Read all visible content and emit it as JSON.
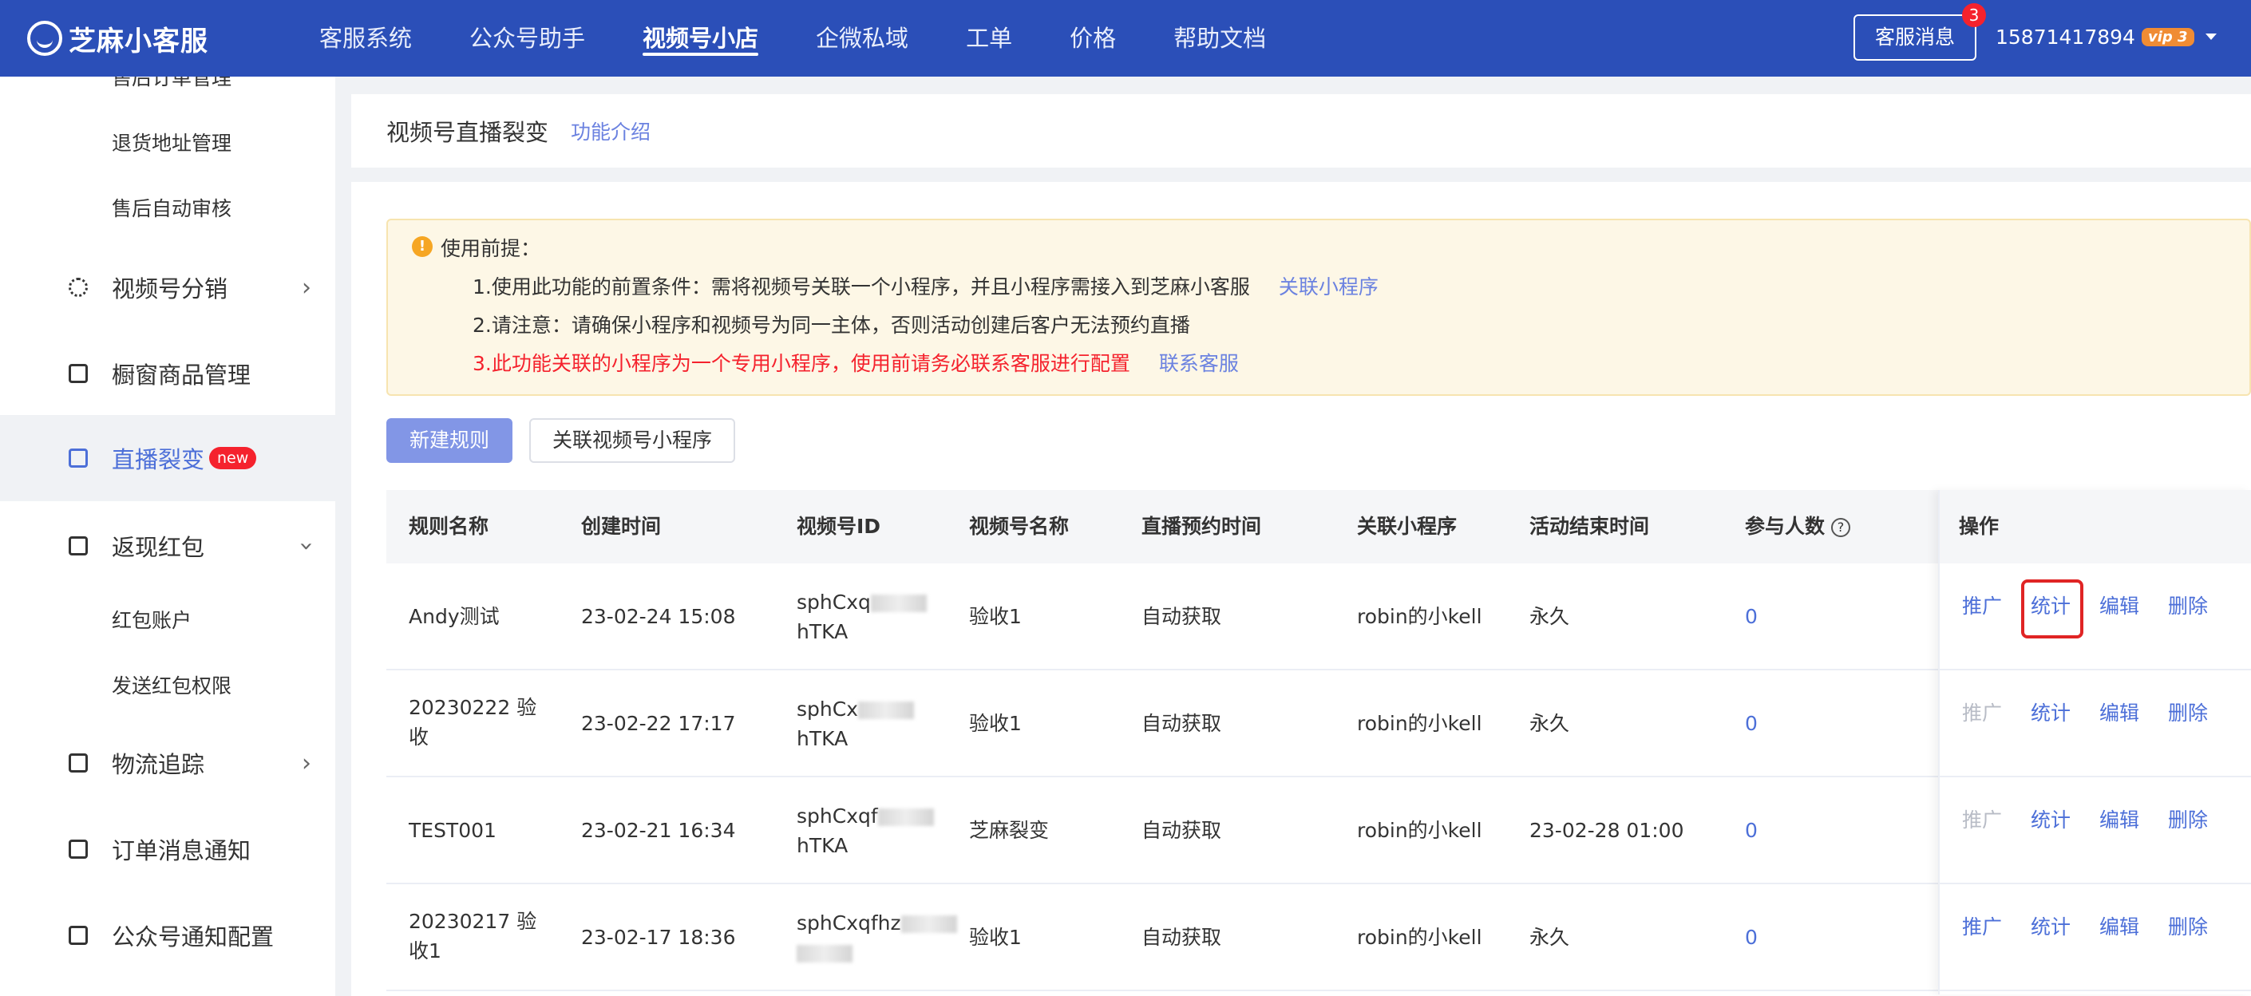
{
  "topbar": {
    "logo_text": "芝麻小客服",
    "nav": [
      "客服系统",
      "公众号助手",
      "视频号小店",
      "企微私域",
      "工单",
      "价格",
      "帮助文档"
    ],
    "active_nav": "视频号小店",
    "message_button": "客服消息",
    "message_badge": "3",
    "user_phone": "15871417894",
    "vip_label": "vip",
    "vip_level": "3"
  },
  "sidebar": {
    "cut_item": "售后订单管理",
    "items": [
      {
        "label": "退货地址管理",
        "level": "sub"
      },
      {
        "label": "售后自动审核",
        "level": "sub"
      },
      {
        "label": "视频号分销",
        "level": "main",
        "arrow": "right",
        "icon": "share-icon"
      },
      {
        "label": "橱窗商品管理",
        "level": "main",
        "icon": "shop-icon"
      },
      {
        "label": "直播裂变",
        "level": "main",
        "icon": "live-icon",
        "badge": "new",
        "active": true
      },
      {
        "label": "返现红包",
        "level": "main",
        "arrow": "down",
        "icon": "redpacket-icon"
      },
      {
        "label": "红包账户",
        "level": "sub"
      },
      {
        "label": "发送红包权限",
        "level": "sub"
      },
      {
        "label": "物流追踪",
        "level": "main",
        "arrow": "right",
        "icon": "truck-icon"
      },
      {
        "label": "订单消息通知",
        "level": "main",
        "icon": "clipboard-icon"
      },
      {
        "label": "公众号通知配置",
        "level": "main",
        "icon": "clipboard-icon"
      }
    ]
  },
  "header": {
    "title": "视频号直播裂变",
    "intro_link": "功能介绍"
  },
  "notice": {
    "title": "使用前提：",
    "line1": "1.使用此功能的前置条件：需将视频号关联一个小程序，并且小程序需接入到芝麻小客服",
    "line1_link": "关联小程序",
    "line2": "2.请注意：请确保小程序和视频号为同一主体，否则活动创建后客户无法预约直播",
    "line3": "3.此功能关联的小程序为一个专用小程序，使用前请务必联系客服进行配置",
    "line3_link": "联系客服"
  },
  "buttons": {
    "new_rule": "新建规则",
    "link_miniprogram": "关联视频号小程序"
  },
  "table": {
    "headers": [
      "规则名称",
      "创建时间",
      "视频号ID",
      "视频号名称",
      "直播预约时间",
      "关联小程序",
      "活动结束时间",
      "参与人数",
      "操作"
    ],
    "help_symbol": "?",
    "rows": [
      {
        "name": "Andy测试",
        "created": "23-02-24 15:08",
        "id_top": "sphCxq",
        "id_bottom": "hTKA",
        "channel": "验收1",
        "reserve": "自动获取",
        "mini": "robin的小kell",
        "end": "永久",
        "count": "0",
        "promote_enabled": true
      },
      {
        "name": "20230222 验收",
        "created": "23-02-22 17:17",
        "id_top": "sphCx",
        "id_bottom": "hTKA",
        "channel": "验收1",
        "reserve": "自动获取",
        "mini": "robin的小kell",
        "end": "永久",
        "count": "0",
        "promote_enabled": false
      },
      {
        "name": "TEST001",
        "created": "23-02-21 16:34",
        "id_top": "sphCxqf",
        "id_bottom": "hTKA",
        "channel": "芝麻裂变",
        "reserve": "自动获取",
        "mini": "robin的小kell",
        "end": "23-02-28 01:00",
        "count": "0",
        "promote_enabled": false
      },
      {
        "name": "20230217 验收1",
        "created": "23-02-17 18:36",
        "id_top": "sphCxqfhz",
        "id_bottom": "",
        "channel": "验收1",
        "reserve": "自动获取",
        "mini": "robin的小kell",
        "end": "永久",
        "count": "0",
        "promote_enabled": true
      }
    ],
    "ops": {
      "promote": "推广",
      "stats": "统计",
      "edit": "编辑",
      "delete": "删除"
    }
  },
  "colors": {
    "primary": "#2b4fb8",
    "link": "#4c6fd8",
    "danger": "#f5222d",
    "highlight_box": "#e02424"
  }
}
